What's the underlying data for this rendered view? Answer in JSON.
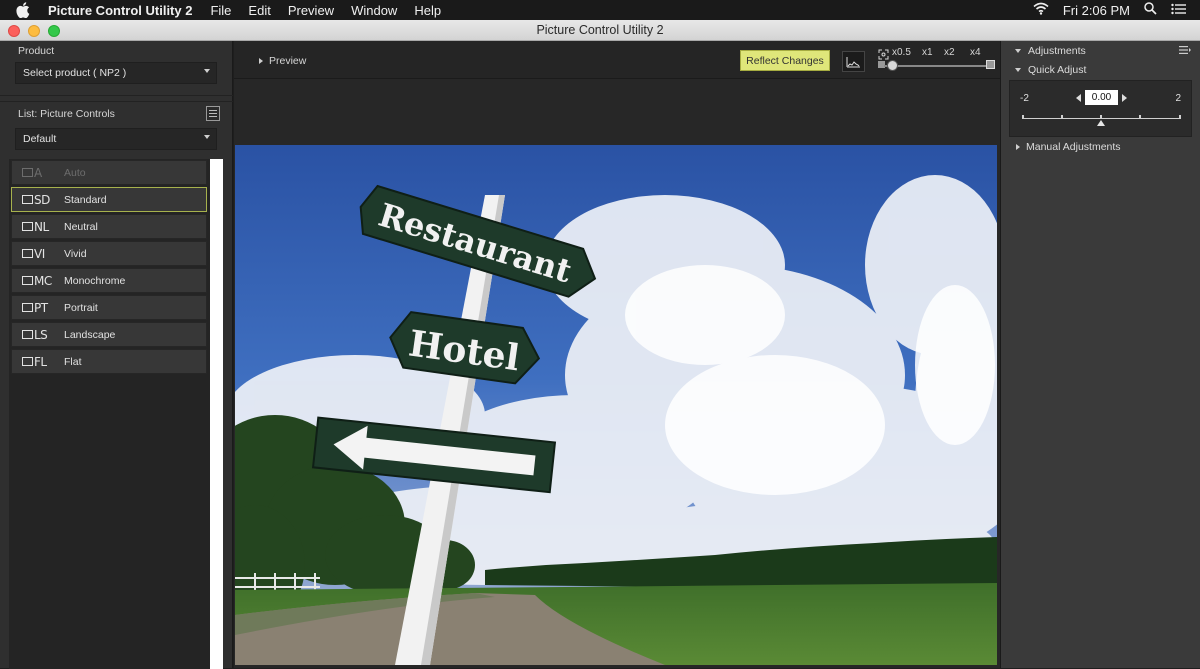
{
  "menubar": {
    "app_name": "Picture Control Utility 2",
    "menus": [
      "File",
      "Edit",
      "Preview",
      "Window",
      "Help"
    ],
    "clock": "Fri 2:06 PM"
  },
  "window": {
    "title": "Picture Control Utility 2"
  },
  "left": {
    "product_label": "Product",
    "product_value": "Select product ( NP2 )",
    "list_label": "List: Picture Controls",
    "list_value": "Default",
    "items": [
      {
        "code": "A",
        "label": "Auto"
      },
      {
        "code": "SD",
        "label": "Standard"
      },
      {
        "code": "NL",
        "label": "Neutral"
      },
      {
        "code": "VI",
        "label": "Vivid"
      },
      {
        "code": "MC",
        "label": "Monochrome"
      },
      {
        "code": "PT",
        "label": "Portrait"
      },
      {
        "code": "LS",
        "label": "Landscape"
      },
      {
        "code": "FL",
        "label": "Flat"
      }
    ]
  },
  "center": {
    "preview_label": "Preview",
    "reflect_label": "Reflect Changes",
    "zoom_options": [
      "x0.5",
      "x1",
      "x2",
      "x4"
    ]
  },
  "photo": {
    "sign1": "Restaurant",
    "sign2": "Hotel"
  },
  "right": {
    "adjustments_label": "Adjustments",
    "quick_adjust_label": "Quick Adjust",
    "quick_min": "-2",
    "quick_max": "2",
    "quick_value": "0.00",
    "manual_label": "Manual Adjustments"
  },
  "colors": {
    "reflect_button": "#dfe67a",
    "selected_border": "#a7b24d"
  },
  "icons": [
    "apple-icon",
    "wifi-icon",
    "search-icon",
    "list-icon",
    "histogram-icon",
    "zoom-fit-icon"
  ]
}
